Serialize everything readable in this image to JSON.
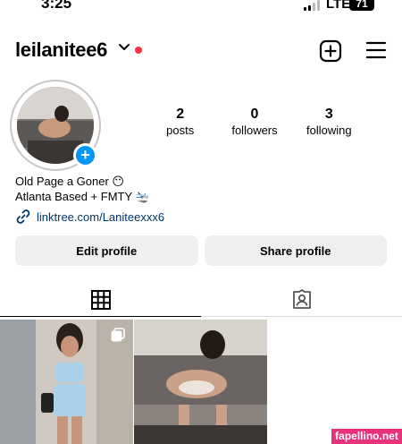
{
  "status_bar": {
    "time": "3:25",
    "network": "LTE",
    "battery": "71"
  },
  "header": {
    "username": "leilanitee6"
  },
  "stats": [
    {
      "value": "2",
      "label": "posts"
    },
    {
      "value": "0",
      "label": "followers"
    },
    {
      "value": "3",
      "label": "following"
    }
  ],
  "bio": {
    "line1": "Old Page a Goner 😶",
    "line2": "Atlanta Based + FMTY 🛬",
    "link": "linktree.com/Laniteexxx6"
  },
  "buttons": {
    "edit_profile": "Edit profile",
    "share_profile": "Share profile"
  },
  "watermark": "fapellino.net",
  "colors": {
    "accent_blue": "#0095f6",
    "notification_red": "#ff3040",
    "link_blue": "#00376b"
  }
}
